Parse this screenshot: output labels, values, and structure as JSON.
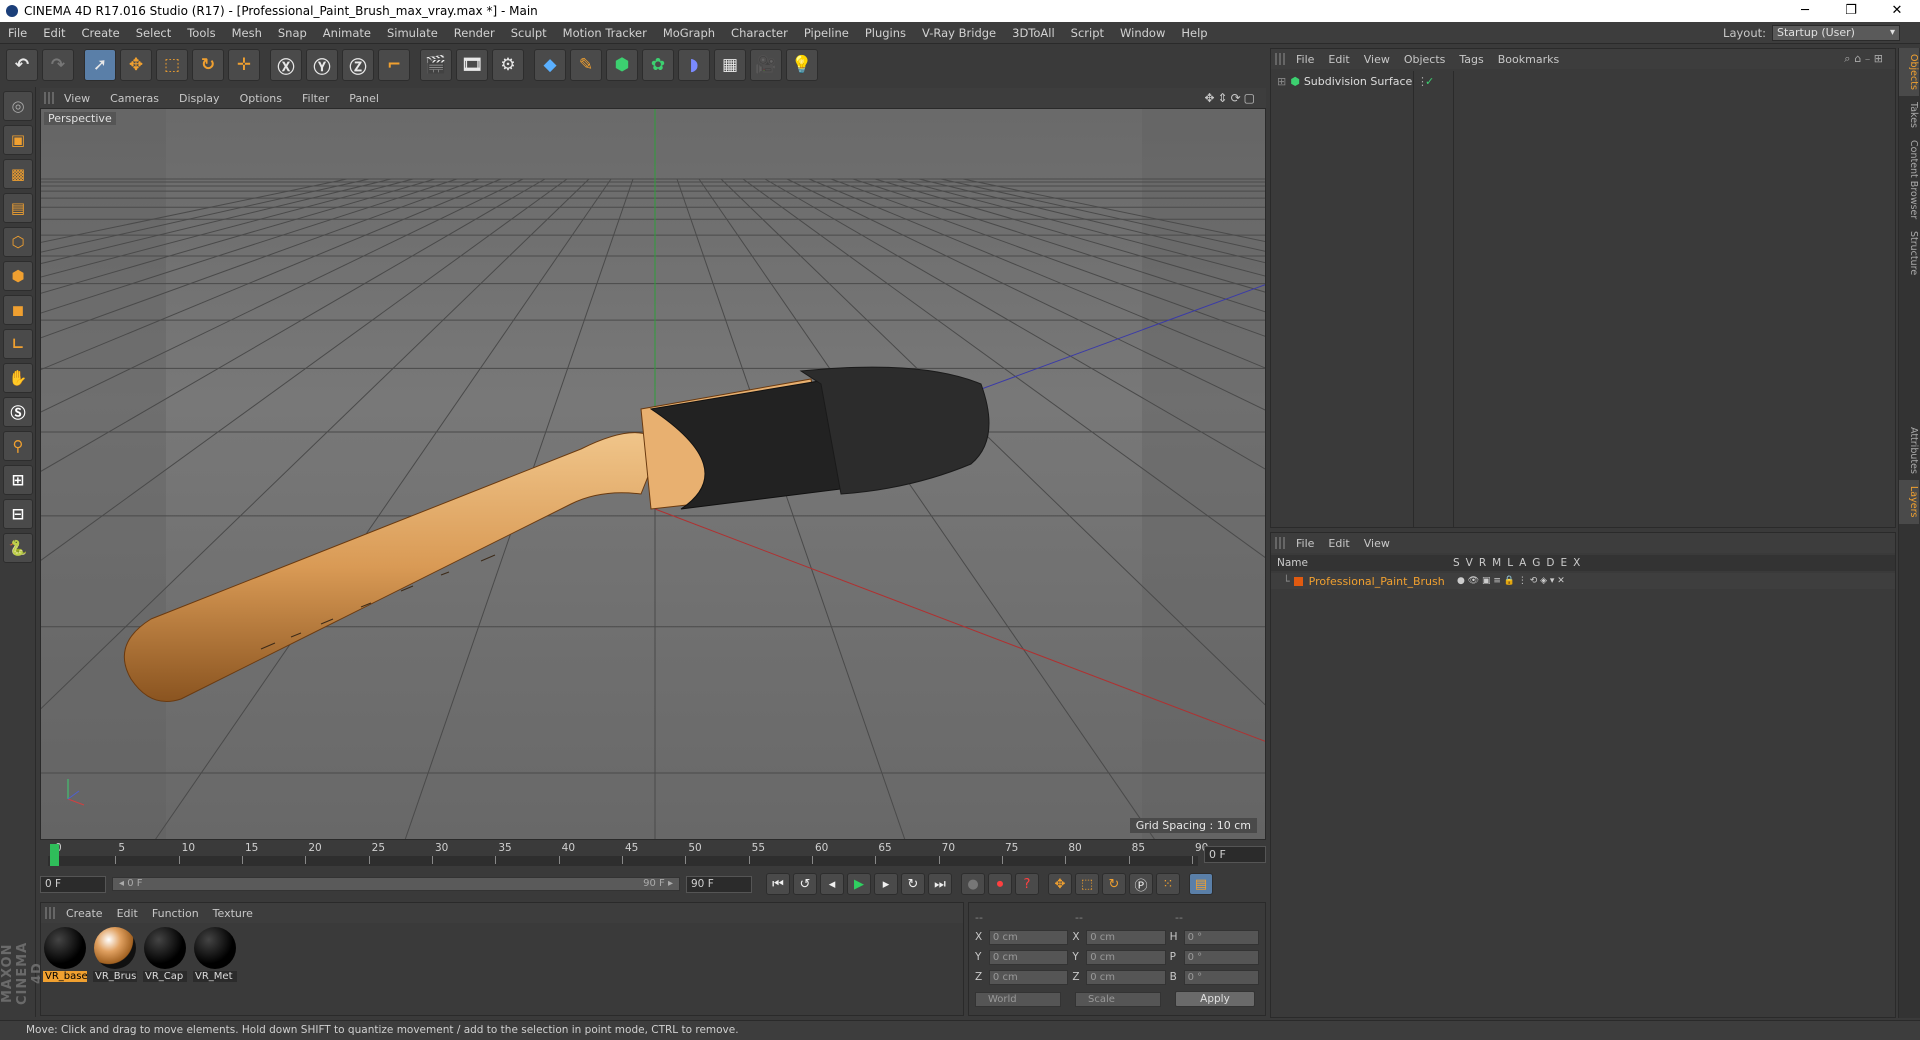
{
  "window": {
    "title": "CINEMA 4D R17.016 Studio (R17) - [Professional_Paint_Brush_max_vray.max *] - Main",
    "controls": [
      "─",
      "❐",
      "✕"
    ]
  },
  "menu": [
    "File",
    "Edit",
    "Create",
    "Select",
    "Tools",
    "Mesh",
    "Snap",
    "Animate",
    "Simulate",
    "Render",
    "Sculpt",
    "Motion Tracker",
    "MoGraph",
    "Character",
    "Pipeline",
    "Plugins",
    "V-Ray Bridge",
    "3DToAll",
    "Script",
    "Window",
    "Help"
  ],
  "layout": {
    "label": "Layout:",
    "value": "Startup (User)"
  },
  "viewport": {
    "menu": [
      "View",
      "Cameras",
      "Display",
      "Options",
      "Filter",
      "Panel"
    ],
    "camera_label": "Perspective",
    "grid_spacing": "Grid Spacing : 10 cm",
    "nav_icons": "✥⇕⟳▢"
  },
  "timeline": {
    "ticks": [
      "0",
      "5",
      "10",
      "15",
      "20",
      "25",
      "30",
      "35",
      "40",
      "45",
      "50",
      "55",
      "60",
      "65",
      "70",
      "75",
      "80",
      "85",
      "90"
    ],
    "current_frame": "0 F",
    "start_field": "0 F",
    "range_start": "◂ 0 F",
    "range_end": "90 F ▸",
    "end_field": "90 F"
  },
  "material_manager": {
    "menu": [
      "Create",
      "Edit",
      "Function",
      "Texture"
    ],
    "materials": [
      "VR_base",
      "VR_Brus",
      "VR_Cap",
      "VR_Met"
    ]
  },
  "coordinates": {
    "header": [
      "--",
      "--",
      "--"
    ],
    "rows": [
      {
        "a": "X",
        "av": "0 cm",
        "b": "X",
        "bv": "0 cm",
        "c": "H",
        "cv": "0 °"
      },
      {
        "a": "Y",
        "av": "0 cm",
        "b": "Y",
        "bv": "0 cm",
        "c": "P",
        "cv": "0 °"
      },
      {
        "a": "Z",
        "av": "0 cm",
        "b": "Z",
        "bv": "0 cm",
        "c": "B",
        "cv": "0 °"
      }
    ],
    "space": "World",
    "mode": "Scale",
    "apply": "Apply"
  },
  "object_manager": {
    "menu": [
      "File",
      "Edit",
      "View",
      "Objects",
      "Tags",
      "Bookmarks"
    ],
    "object": "Subdivision Surface"
  },
  "layer_manager": {
    "menu": [
      "File",
      "Edit",
      "View"
    ],
    "header_name": "Name",
    "columns": [
      "S",
      "V",
      "R",
      "M",
      "L",
      "A",
      "G",
      "D",
      "E",
      "X"
    ],
    "layer": "Professional_Paint_Brush"
  },
  "side_tabs": [
    "Objects",
    "Takes",
    "Content Browser",
    "Structure",
    "Attributes",
    "Layers"
  ],
  "status": "Move: Click and drag to move elements. Hold down SHIFT to quantize movement / add to the selection in point mode, CTRL to remove.",
  "brand": "MAXON CINEMA 4D"
}
